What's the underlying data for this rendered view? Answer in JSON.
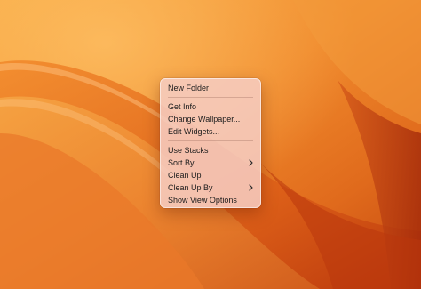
{
  "desktop": {
    "wallpaper_colors": [
      "#f7a23a",
      "#ec7a22",
      "#d04f14",
      "#a92b0c"
    ]
  },
  "context_menu": {
    "groups": [
      [
        {
          "label": "New Folder",
          "has_submenu": false
        }
      ],
      [
        {
          "label": "Get Info",
          "has_submenu": false
        },
        {
          "label": "Change Wallpaper...",
          "has_submenu": false
        },
        {
          "label": "Edit Widgets...",
          "has_submenu": false
        }
      ],
      [
        {
          "label": "Use Stacks",
          "has_submenu": false
        },
        {
          "label": "Sort By",
          "has_submenu": true,
          "icon": "chevron-right-icon"
        },
        {
          "label": "Clean Up",
          "has_submenu": false
        },
        {
          "label": "Clean Up By",
          "has_submenu": true,
          "icon": "chevron-right-icon"
        },
        {
          "label": "Show View Options",
          "has_submenu": false
        }
      ]
    ]
  }
}
